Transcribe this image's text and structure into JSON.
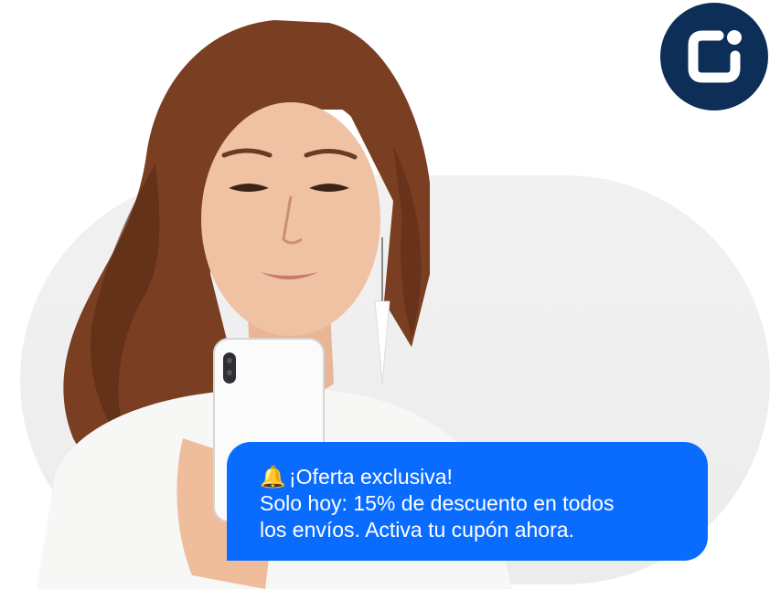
{
  "brand": {
    "logo_icon": "chat-bubble-dot-icon",
    "logo_color": "#0d2e57"
  },
  "notification": {
    "icon": "bell-icon",
    "title": "¡Oferta exclusiva!",
    "line1": "Solo hoy: 15% de descuento en todos",
    "line2": "los envíos. Activa tu cupón ahora.",
    "bubble_color": "#0a6cff"
  }
}
